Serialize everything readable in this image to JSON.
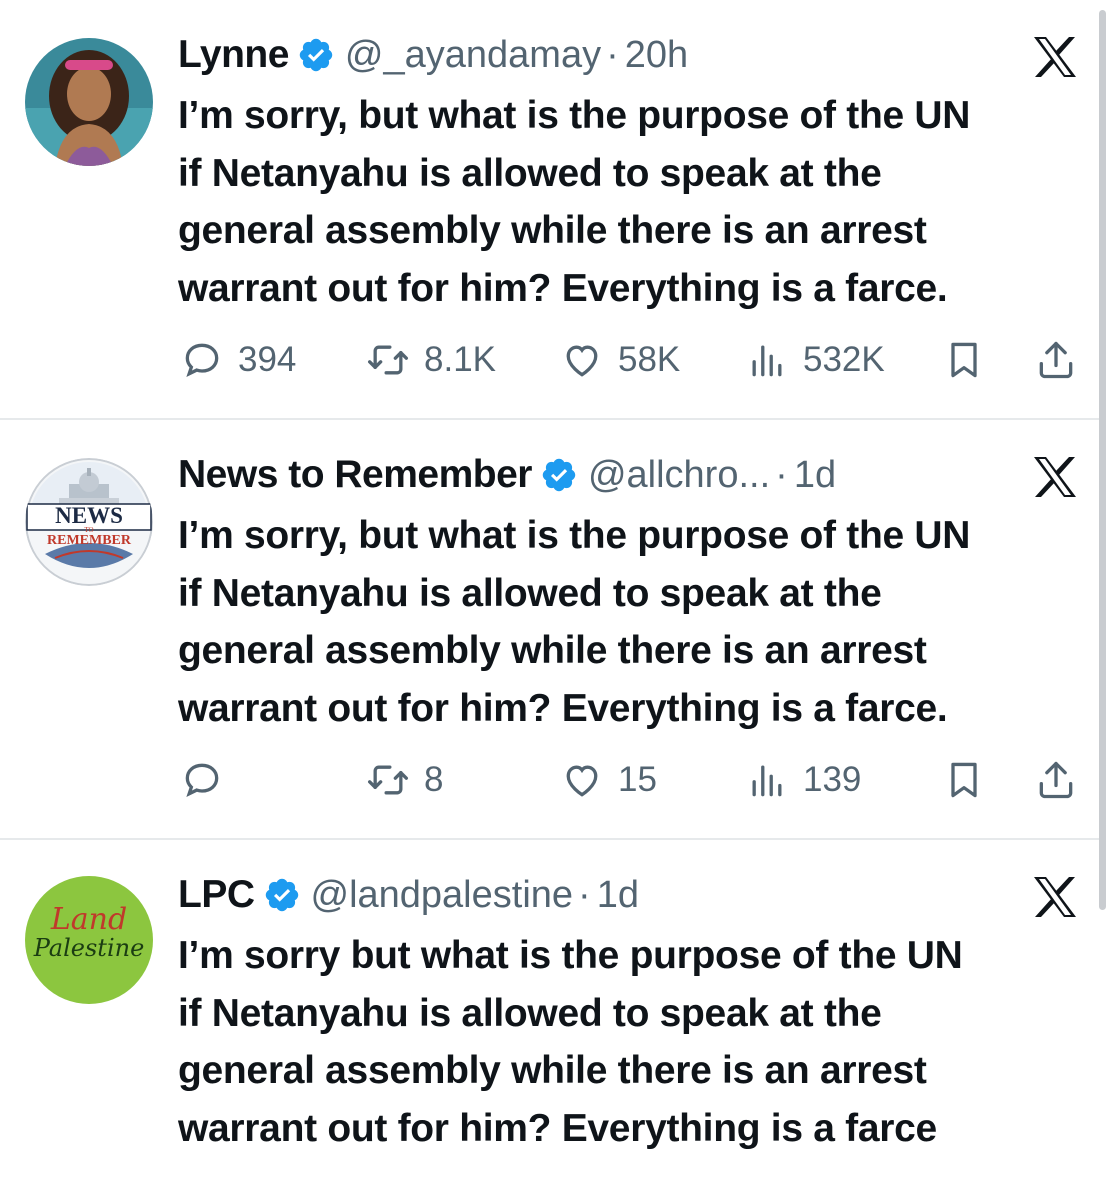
{
  "tweets": [
    {
      "name": "Lynne",
      "handle": "@_ayandamay",
      "dot": "·",
      "time": "20h",
      "body": [
        "I’m sorry, but what is the purpose of the UN",
        "if Netanyahu is allowed to speak at the",
        "general assembly while there is an arrest",
        "warrant out for him? Everything is a farce."
      ],
      "replies": "394",
      "reposts": "8.1K",
      "likes": "58K",
      "views": "532K"
    },
    {
      "name": "News to Remember",
      "handle": "@allchro...",
      "dot": "·",
      "time": "1d",
      "avatar_text_top": "NEWS",
      "avatar_text_mid": "TO",
      "avatar_text_bottom": "REMEMBER",
      "body": [
        "I’m sorry, but what is the purpose of the UN",
        "if Netanyahu is allowed to speak at the",
        "general assembly while there is an arrest",
        "warrant out for him? Everything is a farce."
      ],
      "replies": "",
      "reposts": "8",
      "likes": "15",
      "views": "139"
    },
    {
      "name": "LPC",
      "handle": "@landpalestine",
      "dot": "·",
      "time": "1d",
      "avatar_text_top": "Land",
      "avatar_text_bottom": "Palestine",
      "body": [
        "I’m sorry but what is the purpose of the UN",
        "if Netanyahu is allowed to speak at the",
        "general assembly while there is an arrest",
        "warrant out for him? Everything is a farce"
      ]
    }
  ],
  "icons": {
    "verified": "verified-badge-icon",
    "x_logo": "x-logo-icon",
    "reply": "reply-icon",
    "repost": "repost-icon",
    "like": "heart-icon",
    "views": "views-icon",
    "bookmark": "bookmark-icon",
    "share": "share-icon"
  },
  "colors": {
    "verified_blue": "#1d9bf0",
    "meta_gray": "#536471",
    "text": "#0f1419",
    "lpc_green": "#8cc63f"
  }
}
